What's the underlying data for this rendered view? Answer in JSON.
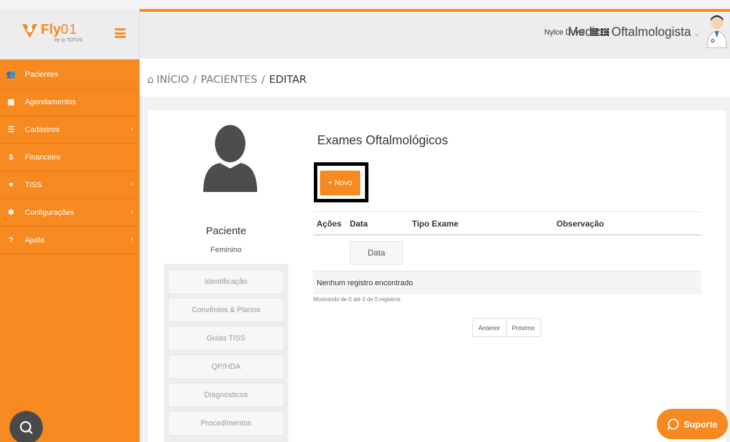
{
  "brand": {
    "name": "Fly",
    "name_suffix": "01",
    "by": "by ◎ TOTVS"
  },
  "header": {
    "user_name": "Nylce Duval",
    "role": "Medico Oftalmologista",
    "role_caret": "⌄"
  },
  "sidebar": {
    "items": [
      {
        "label": "Pacientes",
        "icon": "users-icon",
        "glyph": "👥",
        "has_caret": false
      },
      {
        "label": "Agendamentos",
        "icon": "calendar-icon",
        "glyph": "▦",
        "has_caret": false
      },
      {
        "label": "Cadastros",
        "icon": "list-icon",
        "glyph": "☰",
        "has_caret": true
      },
      {
        "label": "Financeiro",
        "icon": "dollar-icon",
        "glyph": "$",
        "has_caret": false
      },
      {
        "label": "TISS",
        "icon": "heartbeat-icon",
        "glyph": "♥",
        "has_caret": true
      },
      {
        "label": "Configurações",
        "icon": "gear-icon",
        "glyph": "✱",
        "has_caret": true
      },
      {
        "label": "Ajuda",
        "icon": "question-icon",
        "glyph": "?",
        "has_caret": true
      }
    ],
    "caret": "‹"
  },
  "breadcrumb": {
    "home": "INÍCIO",
    "section": "PACIENTES",
    "current": "EDITAR",
    "separator": "/"
  },
  "patient": {
    "name": "Paciente",
    "gender": "Feminino"
  },
  "patient_nav": [
    "Identificação",
    "Convênios & Planos",
    "Guias TISS",
    "QP/HDA",
    "Diagnósticos",
    "Procedimentos"
  ],
  "exams": {
    "title": "Exames Oftalmológicos",
    "new_button": "+ Novo",
    "columns": [
      "Ações",
      "Data",
      "Tipo Exame",
      "Observação"
    ],
    "date_filter": "Data",
    "empty_message": "Nenhum registro encontrado",
    "info": "Mostrando de 0 até 0 de 0 registros",
    "pager": {
      "previous": "Anterior",
      "next": "Próximo"
    }
  },
  "support_button": "Suporte",
  "colors": {
    "accent": "#f6891f",
    "sidebar_bg": "#f6891f",
    "header_bg": "#ededed",
    "chat_bubble": "#4a4a4a"
  }
}
